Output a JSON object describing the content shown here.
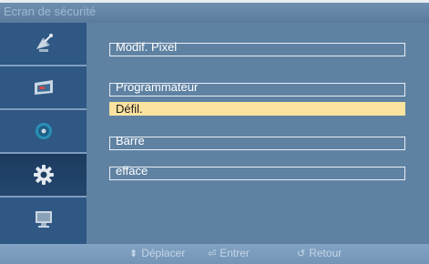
{
  "window": {
    "title": "Ecran de sécurité"
  },
  "sidebar": {
    "items": [
      {
        "icon": "satellite-dish-icon",
        "active": false
      },
      {
        "icon": "tv-screen-icon",
        "active": false
      },
      {
        "icon": "disc-icon",
        "active": false
      },
      {
        "icon": "gear-icon",
        "active": true
      },
      {
        "icon": "monitor-icon",
        "active": false
      }
    ]
  },
  "menu": {
    "items": [
      {
        "label": "Modif. Pixel",
        "selected": false
      },
      {
        "label": "Programmateur",
        "selected": false
      },
      {
        "label": "Défil.",
        "selected": true
      },
      {
        "label": "Barre",
        "selected": false
      },
      {
        "label": "efface",
        "selected": false
      }
    ]
  },
  "footer": {
    "move": {
      "glyph": "⬍",
      "label": "Déplacer"
    },
    "enter": {
      "glyph": "⏎",
      "label": "Entrer"
    },
    "back": {
      "glyph": "↺",
      "label": "Retour"
    }
  },
  "colors": {
    "highlight": "#fde3a0",
    "sidebar": "#2f5884",
    "panel": "#5f82a3"
  }
}
